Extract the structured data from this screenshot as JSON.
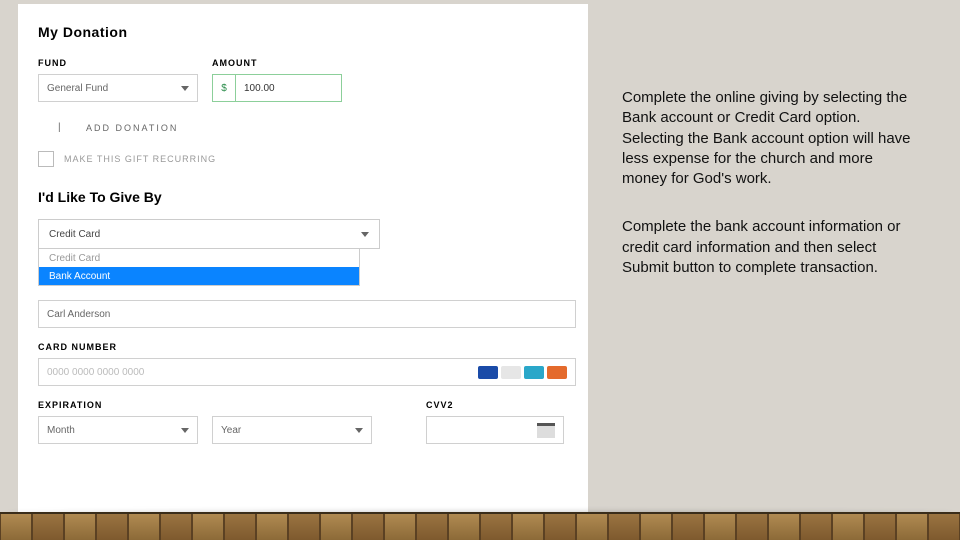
{
  "form": {
    "title": "My Donation",
    "fund": {
      "label": "FUND",
      "value": "General Fund"
    },
    "amount": {
      "label": "AMOUNT",
      "prefix": "$",
      "value": "100.00"
    },
    "add_donation": {
      "plus": "|",
      "label": "ADD DONATION"
    },
    "recurring": "MAKE THIS GIFT RECURRING",
    "give_by_title": "I'd Like To Give By",
    "payment": {
      "selected": "Credit Card",
      "options": [
        "Credit Card",
        "Bank Account"
      ]
    },
    "name_value": "Carl Anderson",
    "card_number": {
      "label": "CARD NUMBER",
      "placeholder": "0000 0000 0000 0000"
    },
    "expiration": {
      "label": "EXPIRATION",
      "month": "Month",
      "year": "Year"
    },
    "cvv_label": "CVV2"
  },
  "instructions": {
    "p1": "Complete the online giving by selecting the Bank account or Credit Card option. Selecting the Bank account option will have less expense for the church and more money for God's work.",
    "p2": "Complete the bank account information or credit card information and then select Submit button to complete transaction."
  }
}
